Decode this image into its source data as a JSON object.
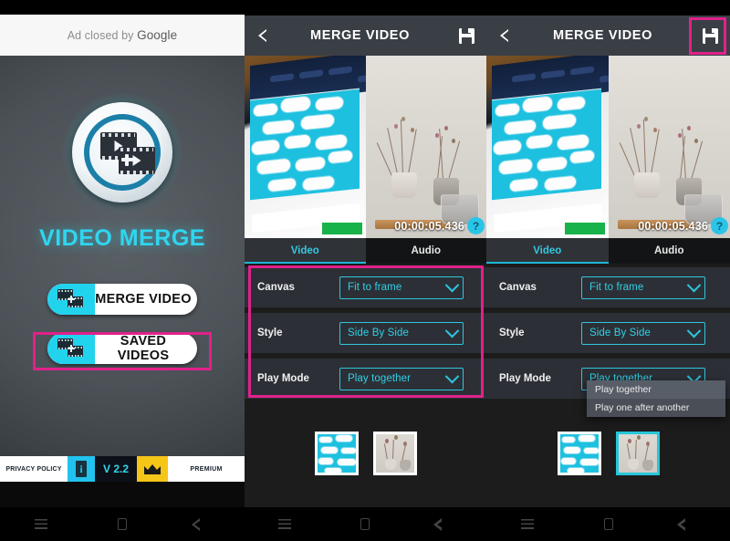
{
  "left_panel": {
    "ad": {
      "text_prefix": "Ad closed by ",
      "brand": "Google"
    },
    "app_title": "VIDEO MERGE",
    "buttons": [
      {
        "label": "MERGE VIDEO",
        "icon": "film-merge-icon",
        "highlighted": true
      },
      {
        "label": "SAVED VIDEOS",
        "icon": "film-merge-icon",
        "highlighted": false
      }
    ],
    "bottom_bar": {
      "privacy_label": "PRIVACY POLICY",
      "info_icon": "info-icon",
      "version": "V 2.2",
      "crown_icon": "crown-icon",
      "premium_label": "PREMIUM"
    }
  },
  "middle_panel": {
    "header": {
      "back_icon": "chevron-left-icon",
      "title": "MERGE VIDEO",
      "save_icon": "save-icon"
    },
    "preview": {
      "timestamp": "00:00:05.436",
      "help_label": "?",
      "left_clip": "clouds-screen-clip",
      "right_clip": "dried-flowers-clip"
    },
    "tabs": [
      {
        "label": "Video",
        "active": true
      },
      {
        "label": "Audio",
        "active": false
      }
    ],
    "settings": [
      {
        "label": "Canvas",
        "value": "Fit to frame"
      },
      {
        "label": "Style",
        "value": "Side By Side"
      },
      {
        "label": "Play Mode",
        "value": "Play together"
      }
    ],
    "thumbnails": [
      {
        "name": "clouds-thumbnail",
        "selected": false
      },
      {
        "name": "flowers-thumbnail",
        "selected": false
      }
    ],
    "highlight": "settings-group"
  },
  "right_panel": {
    "header": {
      "back_icon": "chevron-left-icon",
      "title": "MERGE VIDEO",
      "save_icon": "save-icon"
    },
    "preview": {
      "timestamp": "00:00:05.436",
      "help_label": "?",
      "left_clip": "clouds-screen-clip",
      "right_clip": "dried-flowers-clip"
    },
    "tabs": [
      {
        "label": "Video",
        "active": true
      },
      {
        "label": "Audio",
        "active": false
      }
    ],
    "settings": [
      {
        "label": "Canvas",
        "value": "Fit to frame"
      },
      {
        "label": "Style",
        "value": "Side By Side"
      },
      {
        "label": "Play Mode",
        "value": "Play together"
      }
    ],
    "dropdown": {
      "open": true,
      "options": [
        {
          "label": "Play together",
          "selected": true
        },
        {
          "label": "Play one after another",
          "selected": false
        }
      ]
    },
    "thumbnails": [
      {
        "name": "clouds-thumbnail",
        "selected": false
      },
      {
        "name": "flowers-thumbnail",
        "selected": true
      }
    ],
    "highlight": "save-button"
  },
  "navbars": [
    {
      "recents": "recents-icon",
      "home": "home-icon",
      "back": "back-icon"
    },
    {
      "recents": "recents-icon",
      "home": "home-icon",
      "back": "back-icon"
    },
    {
      "recents": "recents-icon",
      "home": "home-icon",
      "back": "back-icon"
    }
  ],
  "colors": {
    "accent_cyan": "#2fd0e6",
    "highlight_magenta": "#e0218a",
    "header_gray": "#3a3f46",
    "row_gray": "#2c3036",
    "premium_yellow": "#f5c518"
  }
}
